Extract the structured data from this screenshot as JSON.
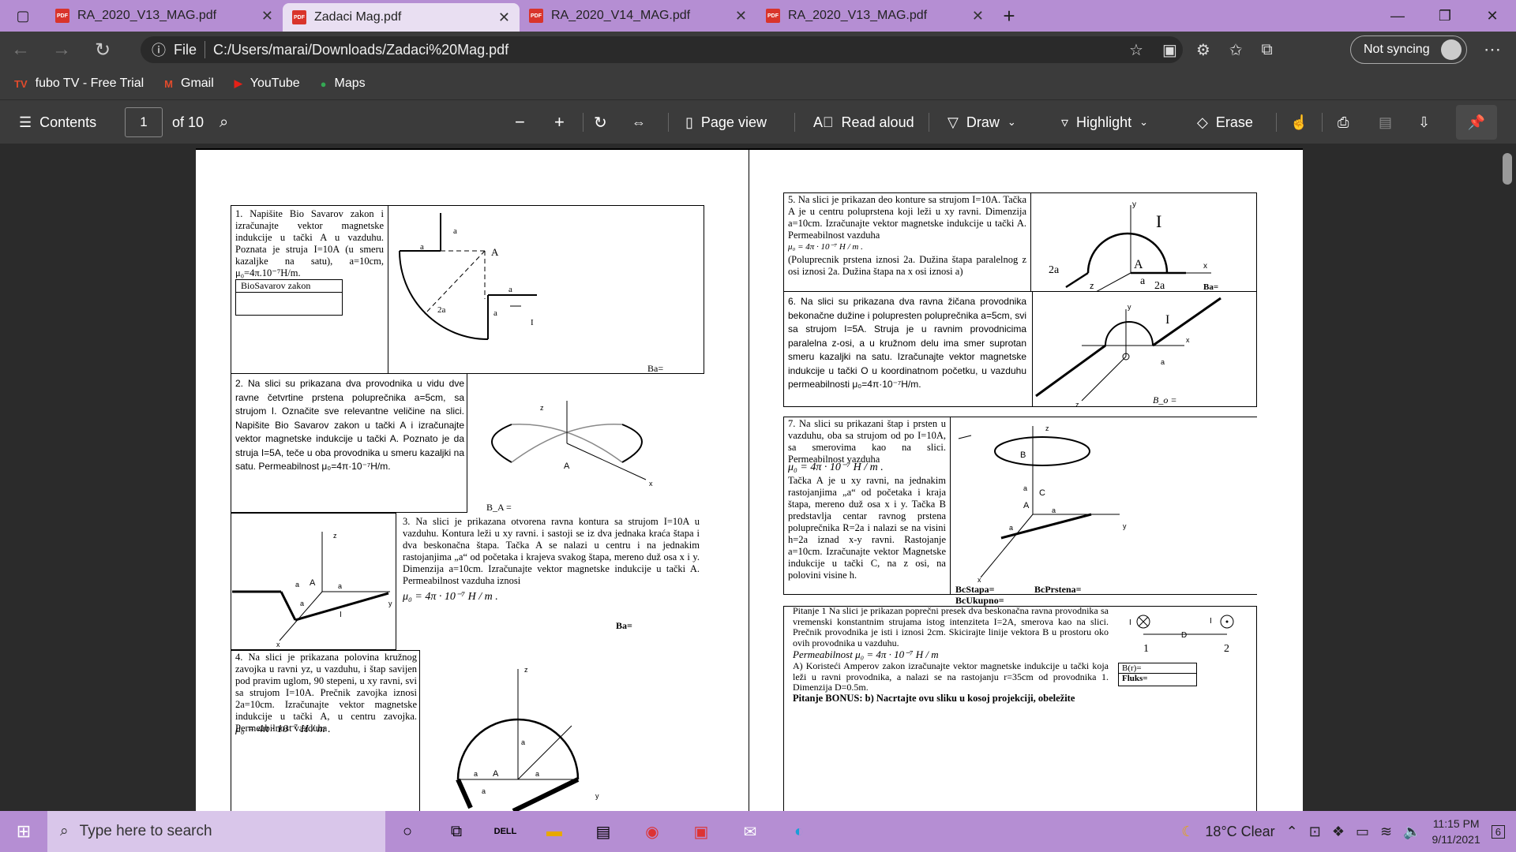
{
  "tabs": [
    {
      "title": "RA_2020_V13_MAG.pdf",
      "active": false
    },
    {
      "title": "Zadaci Mag.pdf",
      "active": true
    },
    {
      "title": "RA_2020_V14_MAG.pdf",
      "active": false
    },
    {
      "title": "RA_2020_V13_MAG.pdf",
      "active": false
    }
  ],
  "address": {
    "scheme_label": "File",
    "url": "C:/Users/marai/Downloads/Zadaci%20Mag.pdf"
  },
  "profile": {
    "sync_label": "Not syncing"
  },
  "bookmarks": [
    "fubo TV - Free Trial",
    "Gmail",
    "YouTube",
    "Maps"
  ],
  "pdf_toolbar": {
    "contents": "Contents",
    "page": "1",
    "page_total": "of 10",
    "page_view": "Page view",
    "read_aloud": "Read aloud",
    "draw": "Draw",
    "highlight": "Highlight",
    "erase": "Erase"
  },
  "doc": {
    "p1": "1. Napišite Bio Savarov zakon i izračunajte vektor magnetske indukcije u tački A u vazduhu. Poznata je struja I=10A (u smeru kazaljke na satu), a=10cm, μ₀=4π.10⁻⁷H/m.",
    "p1_box": "BioSavarov zakon",
    "p1_ba": "Ba=",
    "p2": "2. Na slici su prikazana dva provodnika u vidu dve ravne četvrtine prstena poluprečnika a=5cm, sa strujom I. Označite sve relevantne veličine na slici. Napišite Bio Savarov zakon u tački A i izračunajte vektor magnetske indukcije u tački A. Poznato je da struja I=5A, teče u oba provodnika u smeru kazaljki na satu. Permeabilnost μ₀=4π·10⁻⁷H/m.",
    "p2_ba": "B_A =",
    "p3": "3. Na slici je prikazana otvorena ravna kontura sa strujom I=10A u vazduhu. Kontura leži u xy ravni. i sastoji se iz dva jednaka kraća štapa i dva beskonačna štapa. Tačka A se nalazi u centru i na jednakim rastojanjima „a“ od početaka i krajeva svakog štapa, mereno duž osa x i y. Dimenzija a=10cm. Izračunajte vektor magnetske indukcije u tački A. Permeabilnost vazduha iznosi",
    "p3_mu": "μ₀ = 4π · 10⁻⁷ H / m .",
    "p3_ba": "Ba=",
    "p4": "4. Na slici je prikazana polovina kružnog zavojka u ravni yz, u vazduhu, i štap savijen pod pravim uglom, 90 stepeni, u xy ravni, svi sa strujom I=10A. Prečnik zavojka iznosi 2a=10cm. Izračunajte vektor magnetske indukcije u tački A, u centru zavojka. Permeabilnost vazduha",
    "p4_mu": "μ₀ = 4π · 10⁻⁷ H / m .",
    "p5": "5. Na slici je prikazan deo konture sa strujom I=10A. Tačka A je u centru poluprstena koji leži u xy ravni. Dimenzija a=10cm. Izračunajte vektor magnetske indukcije u tački A. Permeabilnost vazduha",
    "p5_mu": "μ₀ = 4π · 10⁻⁷ H / m .",
    "p5_note": "(Poluprecnik prstena iznosi 2a. Dužina štapa paralelnog z osi iznosi 2a. Dužina štapa na x osi iznosi a)",
    "p5_ba": "Ba=",
    "p6": "6. Na slici su prikazana dva ravna žičana provodnika bekonačne dužine i polupresten poluprečnika a=5cm, svi sa strujom I=5A. Struja je u ravnim provodnicima paralelna z-osi, a u kružnom delu ima smer suprotan smeru kazaljki na satu. Izračunajte vektor magnetske indukcije u tački O u koordinatnom početku, u vazduhu permeabilnosti μ₀=4π·10⁻⁷H/m.",
    "p6_bo": "B_o =",
    "p7": "7. Na slici su prikazani štap i prsten u vazduhu, oba sa strujom od po I=10A, sa smerovima kao na slici. Permeabilnost vazduha",
    "p7_mu": "μ₀ = 4π · 10⁻⁷ H / m .",
    "p7_b": "Tačka A je u xy ravni, na jednakim rastojanjima „a“ od početaka i kraja štapa, mereno duž osa x i y. Tačka B predstavlja centar ravnog prstena poluprečnika R=2a i nalazi se na visini h=2a iznad x-y ravni. Rastojanje a=10cm. Izračunajte vektor Magnetske indukcije u tački C, na z osi, na polovini visine h.",
    "p7_bc1": "BcStapa=",
    "p7_bc2": "BcPrstena=",
    "p7_bc3": "BcUkupno=",
    "q1": "Pitanje 1 Na slici je prikazan poprečni presek dva beskonačna ravna provodnika sa vremenski konstantnim strujama istog intenziteta I=2A, smerova kao na slici. Prečnik provodnika je isti i iznosi 2cm. Skicirajte linije vektora B u prostoru oko ovih provodnika u vazduhu.",
    "q1_mu": "Permeabilnost μ₀ = 4π · 10⁻⁷ H / m",
    "q1_a": "A) Koristeći Amperov zakon izračunajte vektor magnetske indukcije u tački koja leži u ravni provodnika, a nalazi se na rastojanju r=35cm od provodnika 1. Dimenzija D=0.5m.",
    "q1_bonus": "Pitanje BONUS: b) Nacrtajte ovu sliku u kosoj projekciji, obeležite",
    "q1_br": "B(r)=",
    "q1_fluks": "Fluks="
  },
  "taskbar": {
    "search_placeholder": "Type here to search",
    "weather": "18°C  Clear",
    "time": "11:15 PM",
    "date": "9/11/2021",
    "notifications": "6"
  }
}
